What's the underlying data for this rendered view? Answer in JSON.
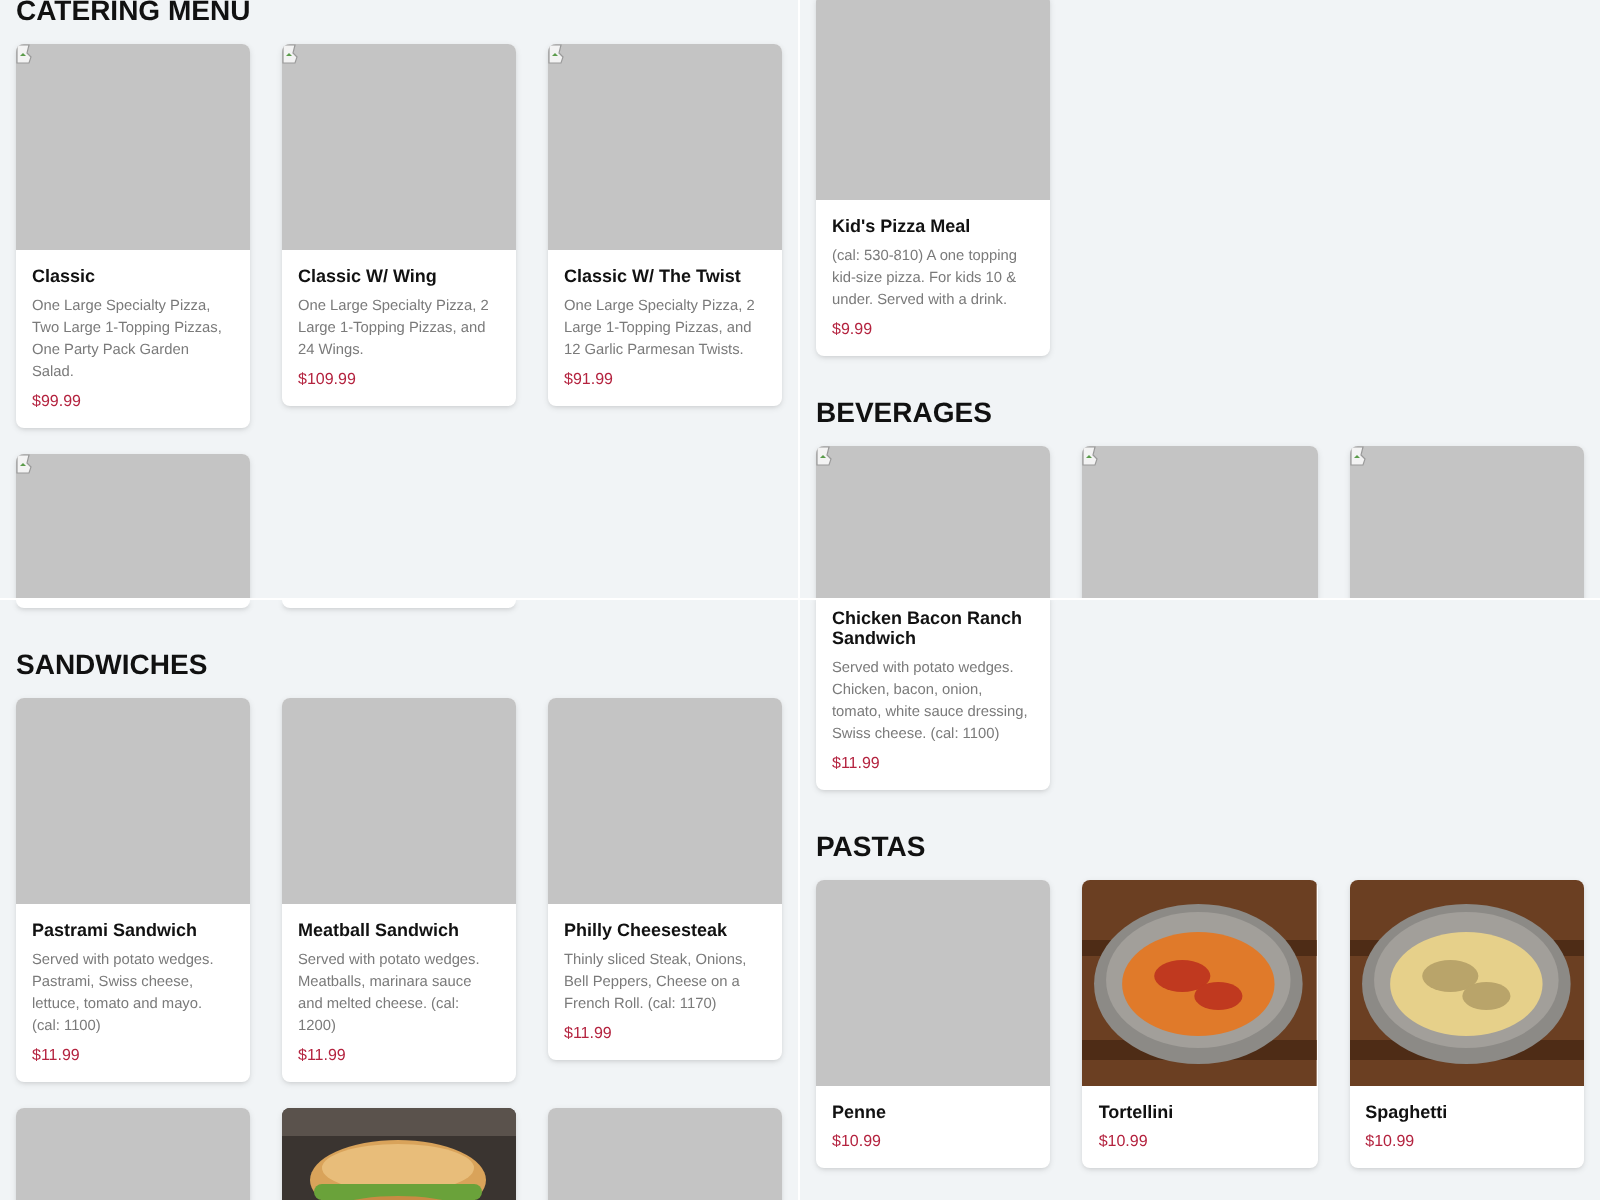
{
  "tiles": [
    {
      "sections": [
        {
          "heading": "CATERING MENU",
          "items": [
            {
              "kind": "broken",
              "name": "Classic",
              "description": "One Large Specialty Pizza, Two Large 1-Topping Pizzas, One Party Pack Garden Salad.",
              "price": "$99.99"
            },
            {
              "kind": "broken",
              "name": "Classic W/ Wing",
              "description": "One Large Specialty Pizza, 2 Large 1-Topping Pizzas, and 24 Wings.",
              "price": "$109.99"
            },
            {
              "kind": "broken",
              "name": "Classic W/ The Twist",
              "description": "One Large Specialty Pizza, 2 Large 1-Topping Pizzas, and 12 Garlic Parmesan Twists.",
              "price": "$91.99"
            },
            {
              "kind": "broken"
            }
          ]
        }
      ]
    },
    {
      "sections": [
        {
          "items": [
            {
              "kind": "blank",
              "name": "Kid's Pizza Meal",
              "description": "(cal: 530-810) A one topping kid-size pizza. For kids 10 & under. Served with a drink.",
              "price": "$9.99"
            }
          ]
        },
        {
          "heading": "BEVERAGES",
          "items": [
            {
              "kind": "broken"
            },
            {
              "kind": "broken"
            },
            {
              "kind": "broken"
            }
          ]
        }
      ]
    },
    {
      "sections": [
        {
          "items": [
            {
              "kind": "card-edge"
            },
            {
              "kind": "card-edge"
            }
          ]
        },
        {
          "heading": "SANDWICHES",
          "items": [
            {
              "kind": "blank",
              "name": "Pastrami Sandwich",
              "description": "Served with potato wedges. Pastrami, Swiss cheese, lettuce, tomato and mayo. (cal: 1100)",
              "price": "$11.99"
            },
            {
              "kind": "blank",
              "name": "Meatball Sandwich",
              "description": "Served with potato wedges. Meatballs, marinara sauce and melted cheese. (cal: 1200)",
              "price": "$11.99"
            },
            {
              "kind": "blank",
              "name": "Philly Cheesesteak",
              "description": "Thinly sliced Steak, Onions, Bell Peppers, Cheese on a French Roll. (cal: 1170)",
              "price": "$11.99"
            },
            {
              "kind": "blank"
            },
            {
              "kind": "picture"
            },
            {
              "kind": "blank"
            }
          ]
        }
      ]
    },
    {
      "sections": [
        {
          "items": [
            {
              "name": "Chicken Bacon Ranch Sandwich",
              "description": "Served with potato wedges. Chicken, bacon, onion, tomato, white sauce dressing, Swiss cheese. (cal: 1100)",
              "price": "$11.99"
            }
          ]
        },
        {
          "heading": "PASTAS",
          "items": [
            {
              "kind": "blank",
              "name": "Penne",
              "price": "$10.99"
            },
            {
              "kind": "picture",
              "name": "Tortellini",
              "price": "$10.99"
            },
            {
              "kind": "picture",
              "name": "Spaghetti",
              "price": "$10.99"
            }
          ]
        }
      ]
    }
  ]
}
